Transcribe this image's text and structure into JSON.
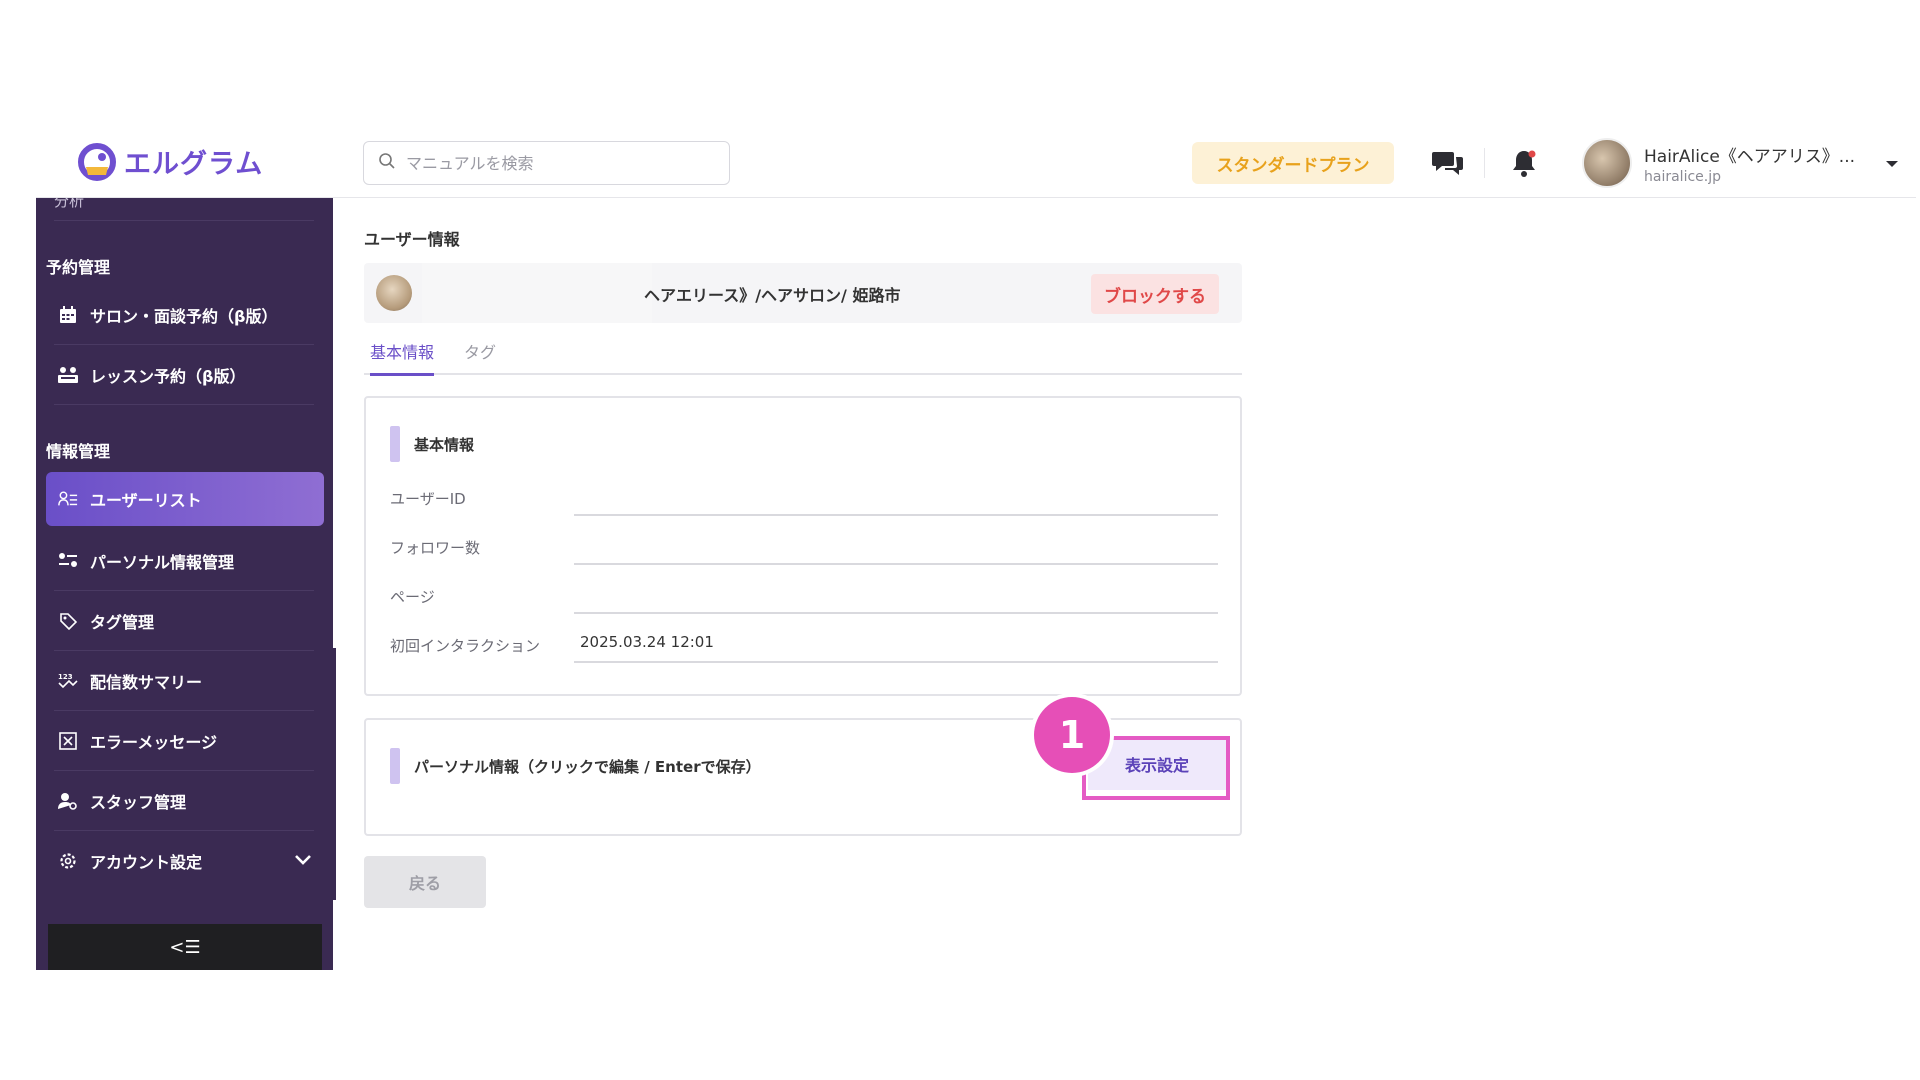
{
  "header": {
    "logo_text": "エルグラム",
    "search_placeholder": "マニュアルを検索",
    "plan_label": "スタンダードプラン",
    "profile_name": "HairAlice《ヘアアリス》...",
    "profile_domain": "hairalice.jp",
    "brand_color": "#6f4fd0"
  },
  "sidebar": {
    "cut_item": "分析",
    "sections": [
      {
        "heading": "予約管理",
        "items": [
          {
            "label": "サロン・面談予約（β版）",
            "icon": "calendar-icon"
          },
          {
            "label": "レッスン予約（β版）",
            "icon": "lesson-icon"
          }
        ]
      },
      {
        "heading": "情報管理",
        "items": [
          {
            "label": "ユーザーリスト",
            "icon": "user-list-icon",
            "active": true
          },
          {
            "label": "パーソナル情報管理",
            "icon": "personal-info-icon"
          },
          {
            "label": "タグ管理",
            "icon": "tag-icon"
          },
          {
            "label": "配信数サマリー",
            "icon": "summary-icon"
          },
          {
            "label": "エラーメッセージ",
            "icon": "error-icon"
          },
          {
            "label": "スタッフ管理",
            "icon": "staff-icon"
          },
          {
            "label": "アカウント設定",
            "icon": "gear-icon",
            "expandable": true
          }
        ]
      }
    ],
    "collapse_label": "<☰"
  },
  "main": {
    "page_title": "ユーザー情報",
    "user_name": "ヘアエリース》/ヘアサロン/ 姫路市",
    "block_label": "ブロックする",
    "tabs": [
      {
        "label": "基本情報",
        "active": true
      },
      {
        "label": "タグ",
        "active": false
      }
    ],
    "basic_card": {
      "title": "基本情報",
      "fields": [
        {
          "label": "ユーザーID",
          "value": ""
        },
        {
          "label": "フォロワー数",
          "value": ""
        },
        {
          "label": "ページ",
          "value": ""
        },
        {
          "label": "初回インタラクション",
          "value": "2025.03.24 12:01"
        }
      ]
    },
    "personal_card": {
      "title": "パーソナル情報（クリックで編集 / Enterで保存）",
      "display_settings_label": "表示設定",
      "step_badge": "1"
    },
    "back_label": "戻る"
  }
}
